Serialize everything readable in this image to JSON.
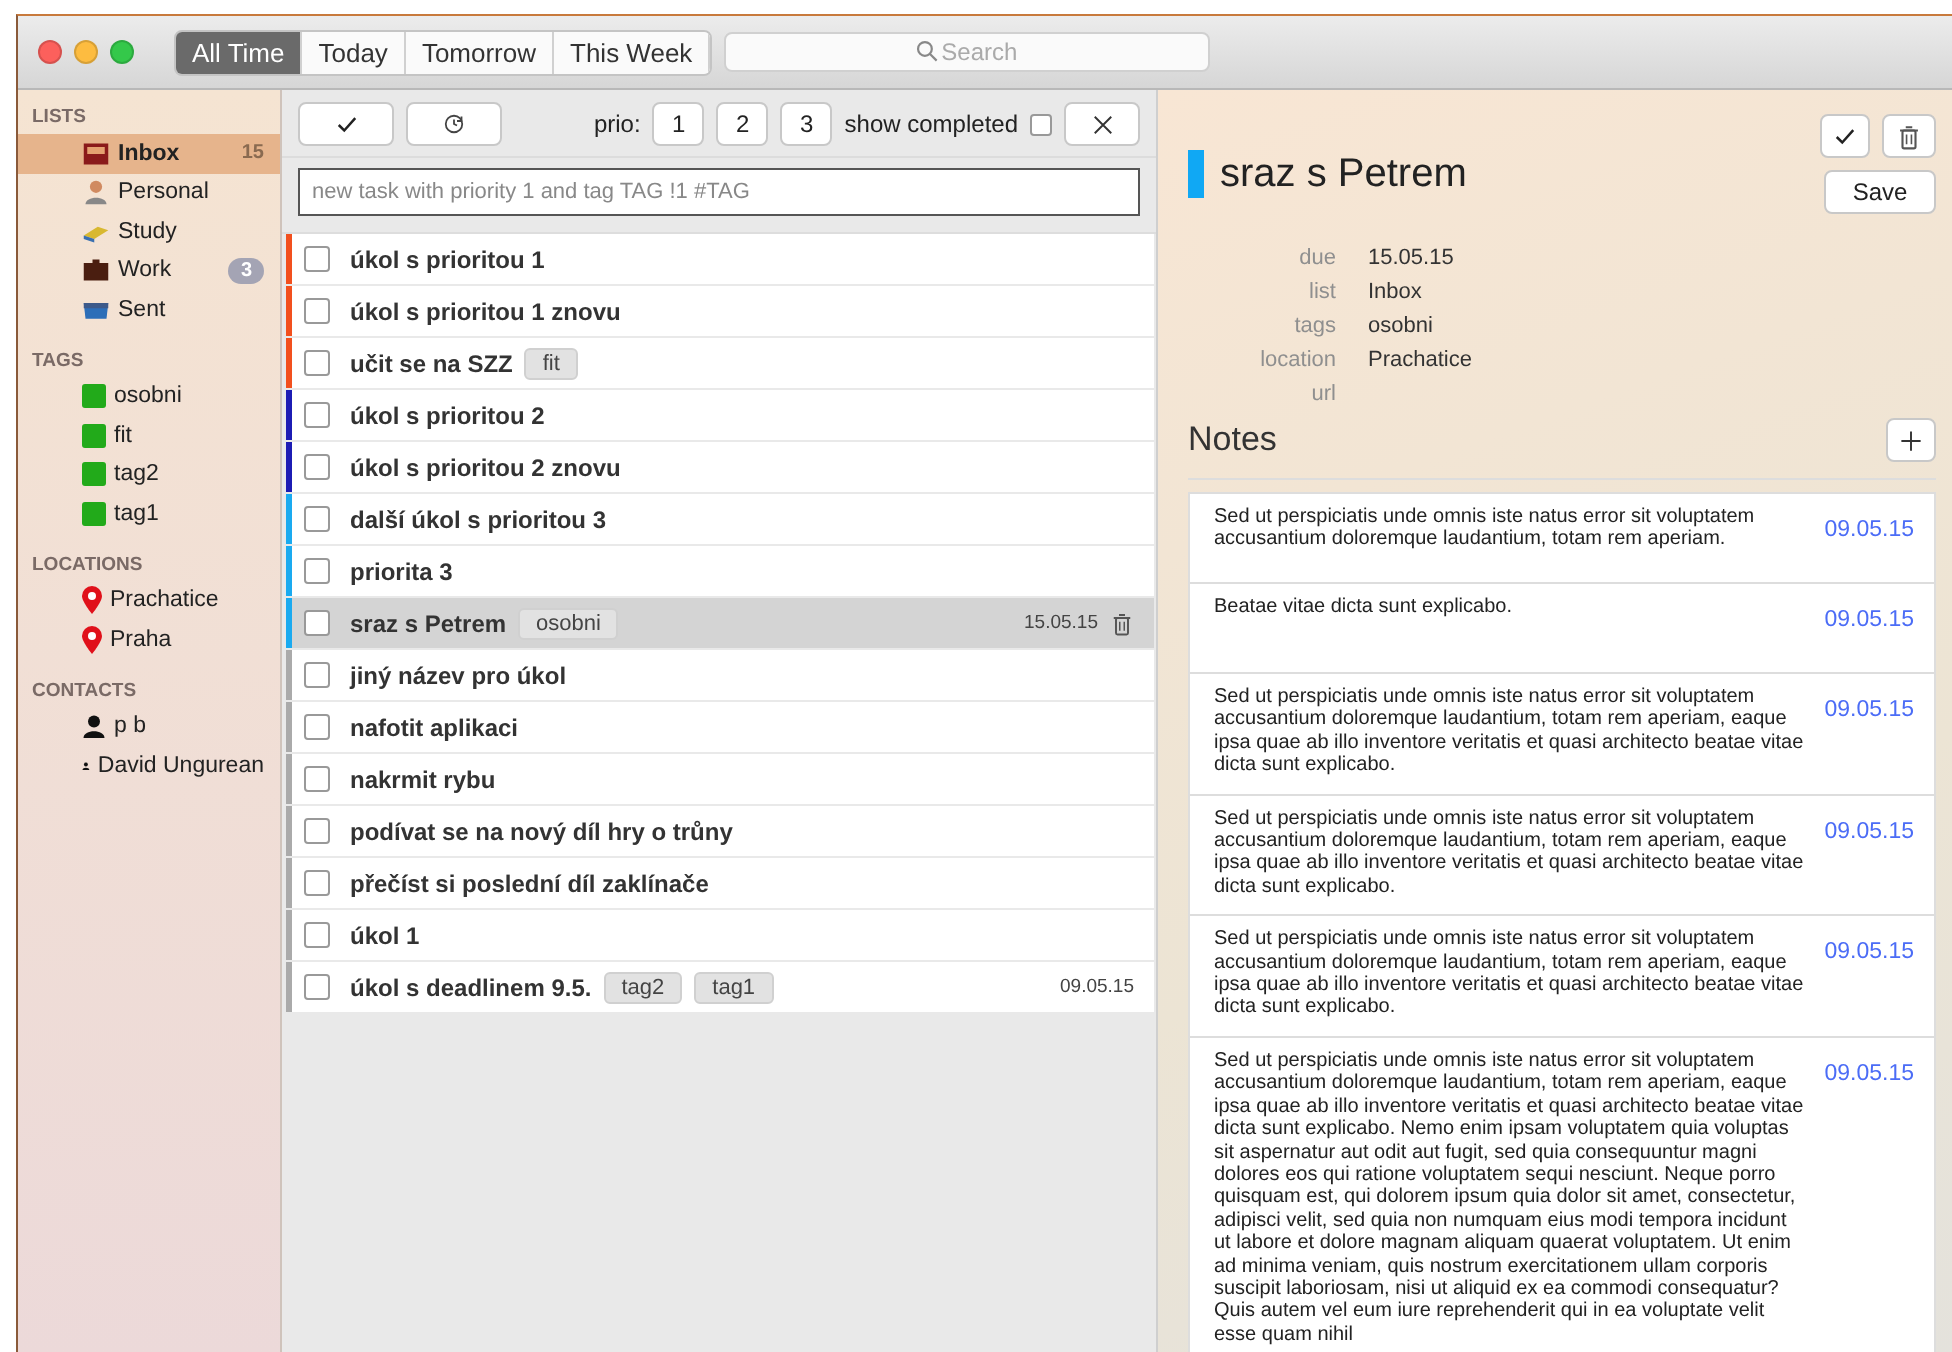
{
  "filters": [
    {
      "label": "All Time",
      "selected": true
    },
    {
      "label": "Today",
      "selected": false
    },
    {
      "label": "Tomorrow",
      "selected": false
    },
    {
      "label": "This Week",
      "selected": false
    }
  ],
  "search": {
    "placeholder": "Search"
  },
  "sidebar": {
    "sections": [
      {
        "title": "LISTS",
        "kind": "list",
        "items": [
          {
            "label": "Inbox",
            "kind": "inbox",
            "count": "15",
            "selected": true
          },
          {
            "label": "Personal",
            "kind": "person",
            "selected": false
          },
          {
            "label": "Study",
            "kind": "books",
            "selected": false
          },
          {
            "label": "Work",
            "kind": "briefcase",
            "count": "3",
            "selected": false
          },
          {
            "label": "Sent",
            "kind": "tray",
            "selected": false
          }
        ]
      },
      {
        "title": "TAGS",
        "kind": "tag",
        "items": [
          {
            "label": "osobni",
            "selected": false
          },
          {
            "label": "fit",
            "selected": false
          },
          {
            "label": "tag2",
            "selected": false
          },
          {
            "label": "tag1",
            "selected": false
          }
        ]
      },
      {
        "title": "LOCATIONS",
        "kind": "location",
        "items": [
          {
            "label": "Prachatice",
            "selected": false
          },
          {
            "label": "Praha",
            "selected": false
          }
        ]
      },
      {
        "title": "CONTACTS",
        "kind": "contact",
        "items": [
          {
            "label": "p b",
            "selected": false
          },
          {
            "label": "David Ungurean",
            "selected": false
          }
        ]
      }
    ]
  },
  "toolbar": {
    "prio_label": "prio:",
    "prio_buttons": [
      "1",
      "2",
      "3"
    ],
    "show_completed": {
      "label": "show completed",
      "checked": false
    }
  },
  "new_task": {
    "placeholder": "new task with priority 1 and tag TAG !1 #TAG"
  },
  "tasks": [
    {
      "title": "úkol s prioritou 1",
      "color": "#f2501e",
      "checked": false,
      "selected": false
    },
    {
      "title": "úkol s prioritou 1 znovu",
      "color": "#f2501e",
      "checked": false,
      "selected": false
    },
    {
      "title": "učit se na SZZ",
      "tags": [
        "fit"
      ],
      "color": "#f2501e",
      "checked": false,
      "selected": false
    },
    {
      "title": "úkol s prioritou 2",
      "color": "#1c1cb4",
      "checked": false,
      "selected": false
    },
    {
      "title": "úkol s prioritou 2 znovu",
      "color": "#1c1cb4",
      "checked": false,
      "selected": false
    },
    {
      "title": "další úkol s prioritou 3",
      "color": "#1aaaf0",
      "checked": false,
      "selected": false
    },
    {
      "title": "priorita 3",
      "color": "#1aaaf0",
      "checked": false,
      "selected": false
    },
    {
      "title": "sraz s Petrem",
      "tags": [
        "osobni"
      ],
      "due": "15.05.15",
      "color": "#1aaaf0",
      "checked": false,
      "selected": true
    },
    {
      "title": "jiný název pro úkol",
      "color": "#aaaaaa",
      "checked": false,
      "selected": false
    },
    {
      "title": "nafotit aplikaci",
      "color": "#aaaaaa",
      "checked": false,
      "selected": false
    },
    {
      "title": "nakrmit rybu",
      "color": "#aaaaaa",
      "checked": false,
      "selected": false
    },
    {
      "title": "podívat se na nový díl hry o trůny",
      "color": "#aaaaaa",
      "checked": false,
      "selected": false
    },
    {
      "title": "přečíst si poslední díl zaklínače",
      "color": "#aaaaaa",
      "checked": false,
      "selected": false
    },
    {
      "title": "úkol 1",
      "color": "#aaaaaa",
      "checked": false,
      "selected": false
    },
    {
      "title": "úkol s deadlinem 9.5.",
      "tags": [
        "tag2",
        "tag1"
      ],
      "due": "09.05.15",
      "color": "#aaaaaa",
      "checked": false,
      "selected": false
    }
  ],
  "detail": {
    "title": "sraz s Petrem",
    "color": "#10a8f4",
    "save": "Save",
    "fields": [
      {
        "label": "due",
        "value": "15.05.15"
      },
      {
        "label": "list",
        "value": "Inbox"
      },
      {
        "label": "tags",
        "value": "osobni"
      },
      {
        "label": "location",
        "value": "Prachatice"
      },
      {
        "label": "url"
      }
    ],
    "notes_title": "Notes",
    "notes": [
      {
        "text": "Sed ut perspiciatis unde omnis iste natus error sit voluptatem accusantium doloremque laudantium, totam rem aperiam.",
        "date": "09.05.15"
      },
      {
        "text": "Beatae vitae dicta sunt explicabo.",
        "date": "09.05.15"
      },
      {
        "text": "Sed ut perspiciatis unde omnis iste natus error sit voluptatem accusantium doloremque laudantium, totam rem aperiam, eaque ipsa quae ab illo inventore veritatis et quasi architecto beatae vitae dicta sunt explicabo.",
        "date": "09.05.15"
      },
      {
        "text": "Sed ut perspiciatis unde omnis iste natus error sit voluptatem accusantium doloremque laudantium, totam rem aperiam, eaque ipsa quae ab illo inventore veritatis et quasi architecto beatae vitae dicta sunt explicabo.",
        "date": "09.05.15"
      },
      {
        "text": "Sed ut perspiciatis unde omnis iste natus error sit voluptatem accusantium doloremque laudantium, totam rem aperiam, eaque ipsa quae ab illo inventore veritatis et quasi architecto beatae vitae dicta sunt explicabo.",
        "date": "09.05.15"
      },
      {
        "text": "Sed ut perspiciatis unde omnis iste natus error sit voluptatem accusantium doloremque laudantium, totam rem aperiam, eaque ipsa quae ab illo inventore veritatis et quasi architecto beatae vitae dicta sunt explicabo. Nemo enim ipsam voluptatem quia voluptas sit aspernatur aut odit aut fugit, sed quia consequuntur magni dolores eos qui ratione voluptatem sequi nesciunt. Neque porro quisquam est, qui dolorem ipsum quia dolor sit amet, consectetur, adipisci velit, sed quia non numquam eius modi tempora incidunt ut labore et dolore magnam aliquam quaerat voluptatem. Ut enim ad minima veniam, quis nostrum exercitationem ullam corporis suscipit laboriosam, nisi ut aliquid ex ea commodi consequatur? Quis autem vel eum iure reprehenderit qui in ea voluptate velit esse quam nihil",
        "date": "09.05.15"
      }
    ]
  }
}
